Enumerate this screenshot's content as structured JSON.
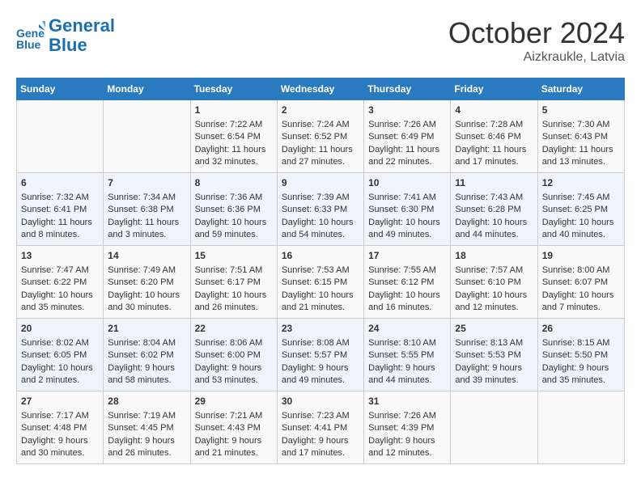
{
  "header": {
    "logo_line1": "General",
    "logo_line2": "Blue",
    "month": "October 2024",
    "location": "Aizkraukle, Latvia"
  },
  "days_of_week": [
    "Sunday",
    "Monday",
    "Tuesday",
    "Wednesday",
    "Thursday",
    "Friday",
    "Saturday"
  ],
  "weeks": [
    [
      {
        "day": "",
        "content": ""
      },
      {
        "day": "",
        "content": ""
      },
      {
        "day": "1",
        "content": "Sunrise: 7:22 AM\nSunset: 6:54 PM\nDaylight: 11 hours and 32 minutes."
      },
      {
        "day": "2",
        "content": "Sunrise: 7:24 AM\nSunset: 6:52 PM\nDaylight: 11 hours and 27 minutes."
      },
      {
        "day": "3",
        "content": "Sunrise: 7:26 AM\nSunset: 6:49 PM\nDaylight: 11 hours and 22 minutes."
      },
      {
        "day": "4",
        "content": "Sunrise: 7:28 AM\nSunset: 6:46 PM\nDaylight: 11 hours and 17 minutes."
      },
      {
        "day": "5",
        "content": "Sunrise: 7:30 AM\nSunset: 6:43 PM\nDaylight: 11 hours and 13 minutes."
      }
    ],
    [
      {
        "day": "6",
        "content": "Sunrise: 7:32 AM\nSunset: 6:41 PM\nDaylight: 11 hours and 8 minutes."
      },
      {
        "day": "7",
        "content": "Sunrise: 7:34 AM\nSunset: 6:38 PM\nDaylight: 11 hours and 3 minutes."
      },
      {
        "day": "8",
        "content": "Sunrise: 7:36 AM\nSunset: 6:36 PM\nDaylight: 10 hours and 59 minutes."
      },
      {
        "day": "9",
        "content": "Sunrise: 7:39 AM\nSunset: 6:33 PM\nDaylight: 10 hours and 54 minutes."
      },
      {
        "day": "10",
        "content": "Sunrise: 7:41 AM\nSunset: 6:30 PM\nDaylight: 10 hours and 49 minutes."
      },
      {
        "day": "11",
        "content": "Sunrise: 7:43 AM\nSunset: 6:28 PM\nDaylight: 10 hours and 44 minutes."
      },
      {
        "day": "12",
        "content": "Sunrise: 7:45 AM\nSunset: 6:25 PM\nDaylight: 10 hours and 40 minutes."
      }
    ],
    [
      {
        "day": "13",
        "content": "Sunrise: 7:47 AM\nSunset: 6:22 PM\nDaylight: 10 hours and 35 minutes."
      },
      {
        "day": "14",
        "content": "Sunrise: 7:49 AM\nSunset: 6:20 PM\nDaylight: 10 hours and 30 minutes."
      },
      {
        "day": "15",
        "content": "Sunrise: 7:51 AM\nSunset: 6:17 PM\nDaylight: 10 hours and 26 minutes."
      },
      {
        "day": "16",
        "content": "Sunrise: 7:53 AM\nSunset: 6:15 PM\nDaylight: 10 hours and 21 minutes."
      },
      {
        "day": "17",
        "content": "Sunrise: 7:55 AM\nSunset: 6:12 PM\nDaylight: 10 hours and 16 minutes."
      },
      {
        "day": "18",
        "content": "Sunrise: 7:57 AM\nSunset: 6:10 PM\nDaylight: 10 hours and 12 minutes."
      },
      {
        "day": "19",
        "content": "Sunrise: 8:00 AM\nSunset: 6:07 PM\nDaylight: 10 hours and 7 minutes."
      }
    ],
    [
      {
        "day": "20",
        "content": "Sunrise: 8:02 AM\nSunset: 6:05 PM\nDaylight: 10 hours and 2 minutes."
      },
      {
        "day": "21",
        "content": "Sunrise: 8:04 AM\nSunset: 6:02 PM\nDaylight: 9 hours and 58 minutes."
      },
      {
        "day": "22",
        "content": "Sunrise: 8:06 AM\nSunset: 6:00 PM\nDaylight: 9 hours and 53 minutes."
      },
      {
        "day": "23",
        "content": "Sunrise: 8:08 AM\nSunset: 5:57 PM\nDaylight: 9 hours and 49 minutes."
      },
      {
        "day": "24",
        "content": "Sunrise: 8:10 AM\nSunset: 5:55 PM\nDaylight: 9 hours and 44 minutes."
      },
      {
        "day": "25",
        "content": "Sunrise: 8:13 AM\nSunset: 5:53 PM\nDaylight: 9 hours and 39 minutes."
      },
      {
        "day": "26",
        "content": "Sunrise: 8:15 AM\nSunset: 5:50 PM\nDaylight: 9 hours and 35 minutes."
      }
    ],
    [
      {
        "day": "27",
        "content": "Sunrise: 7:17 AM\nSunset: 4:48 PM\nDaylight: 9 hours and 30 minutes."
      },
      {
        "day": "28",
        "content": "Sunrise: 7:19 AM\nSunset: 4:45 PM\nDaylight: 9 hours and 26 minutes."
      },
      {
        "day": "29",
        "content": "Sunrise: 7:21 AM\nSunset: 4:43 PM\nDaylight: 9 hours and 21 minutes."
      },
      {
        "day": "30",
        "content": "Sunrise: 7:23 AM\nSunset: 4:41 PM\nDaylight: 9 hours and 17 minutes."
      },
      {
        "day": "31",
        "content": "Sunrise: 7:26 AM\nSunset: 4:39 PM\nDaylight: 9 hours and 12 minutes."
      },
      {
        "day": "",
        "content": ""
      },
      {
        "day": "",
        "content": ""
      }
    ]
  ]
}
